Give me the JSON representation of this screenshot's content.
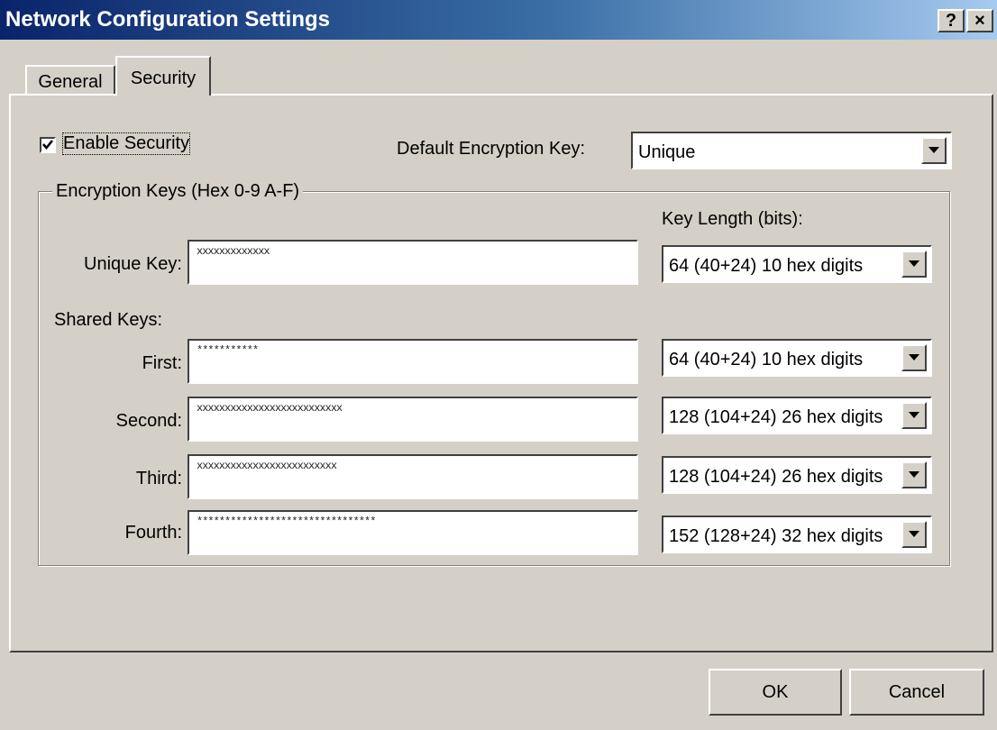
{
  "window": {
    "title": "Network Configuration Settings",
    "help_label": "?",
    "close_label": "×"
  },
  "tabs": [
    {
      "label": "General",
      "selected": false
    },
    {
      "label": "Security",
      "selected": true
    }
  ],
  "security": {
    "enable_security": {
      "label": "Enable Security",
      "checked": true
    },
    "default_encryption_key": {
      "label": "Default Encryption Key:",
      "value": "Unique"
    },
    "group_title": "Encryption Keys (Hex 0-9 A-F)",
    "key_length_header": "Key Length (bits):",
    "unique_key": {
      "label": "Unique Key:",
      "value": "xxxxxxxxxxxxx",
      "length": "64 (40+24) 10 hex digits"
    },
    "shared_keys_label": "Shared Keys:",
    "shared": [
      {
        "label": "First:",
        "value": "***********",
        "length": "64 (40+24) 10 hex digits"
      },
      {
        "label": "Second:",
        "value": "xxxxxxxxxxxxxxxxxxxxxxxxxx",
        "length": "128 (104+24) 26 hex digits"
      },
      {
        "label": "Third:",
        "value": "xxxxxxxxxxxxxxxxxxxxxxxxx",
        "length": "128 (104+24) 26 hex digits"
      },
      {
        "label": "Fourth:",
        "value": "********************************",
        "length": "152 (128+24) 32 hex digits"
      }
    ]
  },
  "buttons": {
    "ok": "OK",
    "cancel": "Cancel"
  }
}
